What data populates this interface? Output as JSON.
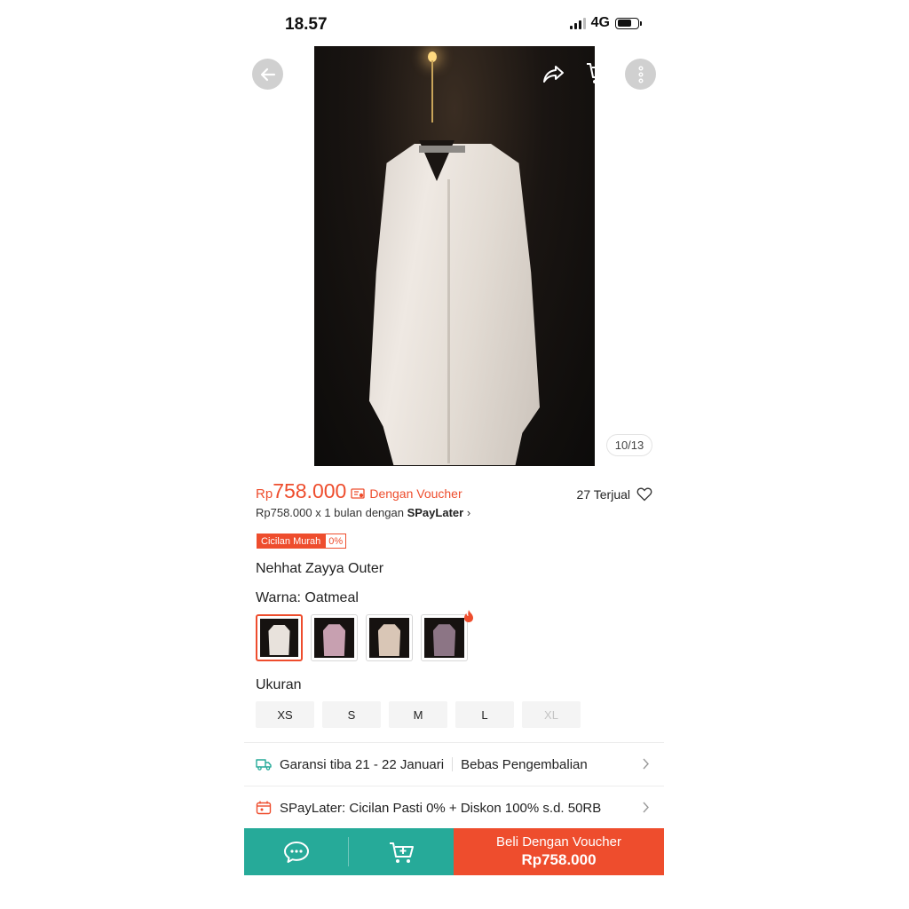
{
  "status_bar": {
    "time": "18.57",
    "network": "4G"
  },
  "product": {
    "image_counter": "10/13",
    "price_prefix": "Rp",
    "price_value": "758.000",
    "voucher_text": "Dengan Voucher",
    "sold": "27 Terjual",
    "spaylater_prefix": "Rp758.000 x 1 bulan dengan ",
    "spaylater_brand": "SPayLater",
    "spaylater_chevron": "›",
    "cicilan_label": "Cicilan Murah",
    "cicilan_pct": "0%",
    "name": "Nehhat Zayya Outer",
    "warna_label": "Warna:",
    "warna_value": " Oatmeal",
    "swatches": [
      {
        "color": "#e8e2dc",
        "selected": true
      },
      {
        "color": "#c7a0b0",
        "selected": false
      },
      {
        "color": "#d9c6b6",
        "selected": false
      },
      {
        "color": "#8c7585",
        "selected": false,
        "badge": "flame-icon"
      }
    ],
    "ukuran_label": "Ukuran",
    "sizes": [
      {
        "label": "XS",
        "available": true
      },
      {
        "label": "S",
        "available": true
      },
      {
        "label": "M",
        "available": true
      },
      {
        "label": "L",
        "available": true
      },
      {
        "label": "XL",
        "available": false
      }
    ]
  },
  "info_rows": {
    "shipping": "Garansi tiba 21 - 22 Januari",
    "returns": "Bebas Pengembalian",
    "spaylater_promo": "SPayLater: Cicilan Pasti 0% + Diskon 100% s.d. 50RB"
  },
  "bottom_bar": {
    "buy_label": "Beli Dengan Voucher",
    "buy_price": "Rp758.000"
  },
  "colors": {
    "accent": "#ee4d2d",
    "teal": "#26aa99"
  }
}
